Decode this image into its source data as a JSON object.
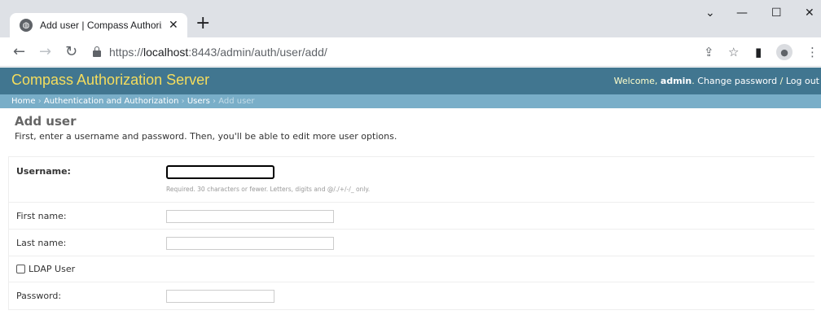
{
  "browser": {
    "tab_title": "Add user | Compass Authorizatio",
    "tab_close": "✕",
    "new_tab": "+",
    "url_scheme": "https://",
    "url_host": "localhost",
    "url_rest": ":8443/admin/auth/user/add/",
    "window_controls": {
      "dropdown": "⌄",
      "minimize": "—",
      "maximize": "☐",
      "close": "✕"
    },
    "nav": {
      "back": "←",
      "forward": "→",
      "reload": "↻"
    },
    "icons": {
      "share": "⇪",
      "star": "☆",
      "sidepanel": "▮",
      "menu": "⋮",
      "profile": "●"
    }
  },
  "header": {
    "branding": "Compass Authorization Server",
    "welcome_prefix": "Welcome, ",
    "username": "admin",
    "welcome_suffix": ". ",
    "change_password": "Change password",
    "separator": " / ",
    "log_out": "Log out"
  },
  "breadcrumbs": {
    "home": "Home",
    "sep": " › ",
    "app": "Authentication and Authorization",
    "model": "Users",
    "current": "Add user"
  },
  "page": {
    "title": "Add user",
    "intro": "First, enter a username and password. Then, you'll be able to edit more user options."
  },
  "form": {
    "username_label": "Username:",
    "username_value": "",
    "username_help": "Required. 30 characters or fewer. Letters, digits and @/./+/-/_ only.",
    "first_name_label": "First name:",
    "first_name_value": "",
    "last_name_label": "Last name:",
    "last_name_value": "",
    "ldap_label": "LDAP User",
    "ldap_checked": false,
    "password_label": "Password:",
    "password_value": ""
  }
}
